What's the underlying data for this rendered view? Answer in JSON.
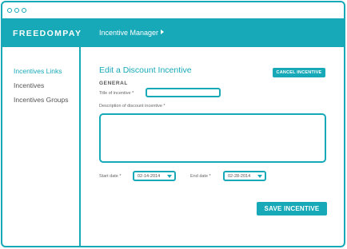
{
  "app": {
    "brand": "FREEDOMPAY",
    "module": "Incentive Manager"
  },
  "sidebar": {
    "items": [
      {
        "label": "Incentives Links",
        "active": true
      },
      {
        "label": "Incentives",
        "active": false
      },
      {
        "label": "Incentives Groups",
        "active": false
      }
    ]
  },
  "form": {
    "heading": "Edit a Discount Incentive",
    "cancel_label": "CANCEL INCENTIVE",
    "section": "GENERAL",
    "title_label": "Title of incentive *",
    "title_value": "",
    "description_label": "Description of discount incentive *",
    "description_value": "",
    "start_label": "Start date *",
    "start_value": "02-14-2014",
    "end_label": "End date *",
    "end_value": "02-28-2014",
    "save_label": "SAVE INCENTIVE"
  },
  "colors": {
    "accent": "#17a9b8"
  },
  "icons": {
    "module": "chevron-right-icon",
    "dropdown": "chevron-down-icon"
  }
}
